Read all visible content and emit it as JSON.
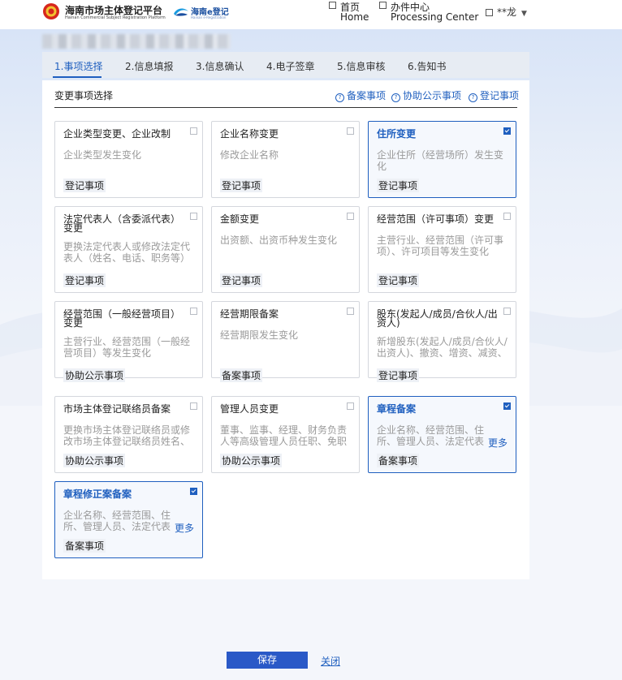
{
  "header": {
    "logo_cn": "海南市场主体登记平台",
    "logo_en": "Hainan Commercial Subject Registration Platform",
    "logo2_text": "海南e登记",
    "logo2_sub": "Hainan e-Registration",
    "nav": [
      {
        "cn": "首页",
        "en": "Home"
      },
      {
        "cn": "办件中心",
        "en": "Processing Center"
      }
    ],
    "user_name": "**龙"
  },
  "steps": [
    "1.事项选择",
    "2.信息填报",
    "3.信息确认",
    "4.电子签章",
    "5.信息审核",
    "6.告知书"
  ],
  "panel": {
    "title": "变更事项选择",
    "help_links": [
      "备案事项",
      "协助公示事项",
      "登记事项"
    ]
  },
  "cards": [
    {
      "title": "企业类型变更、企业改制",
      "desc": "企业类型发生变化",
      "tag": "登记事项",
      "selected": false
    },
    {
      "title": "企业名称变更",
      "desc": "修改企业名称",
      "tag": "登记事项",
      "selected": false
    },
    {
      "title": "住所变更",
      "desc": "企业住所（经营场所）发生变化",
      "tag": "登记事项",
      "selected": true
    },
    {
      "title": "法定代表人（含委派代表）变更",
      "desc": "更换法定代表人或修改法定代表人（姓名、电话、职务等）",
      "tag": "登记事项",
      "selected": false
    },
    {
      "title": "金额变更",
      "desc": "出资额、出资币种发生变化",
      "tag": "登记事项",
      "selected": false
    },
    {
      "title": "经营范围（许可事项）变更",
      "desc": "主营行业、经营范围（许可事项）、许可项目等发生变化",
      "tag": "登记事项",
      "selected": false
    },
    {
      "title": "经营范围（一般经营项目）变更",
      "desc": "主营行业、经营范围（一般经营项目）等发生变化",
      "tag": "协助公示事项",
      "selected": false
    },
    {
      "title": "经营期限备案",
      "desc": "经营期限发生变化",
      "tag": "备案事项",
      "selected": false
    },
    {
      "title": "股东(发起人/成员/合伙人/出资人)",
      "desc": "新增股东(发起人/成员/合伙人/出资人)、撤资、增资、减资、",
      "tag": "登记事项",
      "selected": false
    },
    {
      "title": "市场主体登记联络员备案",
      "desc": "更换市场主体登记联络员或修改市场主体登记联络员姓名、",
      "tag": "协助公示事项",
      "selected": false
    },
    {
      "title": "管理人员变更",
      "desc": "董事、监事、经理、财务负责人等高级管理人员任职、免职",
      "tag": "协助公示事项",
      "selected": false
    },
    {
      "title": "章程备案",
      "desc": "企业名称、经营范围、住所、管理人员、法定代表人、...",
      "tag": "备案事项",
      "selected": true,
      "more": "更多"
    },
    {
      "title": "章程修正案备案",
      "desc": "企业名称、经营范围、住所、管理人员、法定代表人、...",
      "tag": "备案事项",
      "selected": true,
      "more": "更多"
    }
  ],
  "footer": {
    "save": "保存",
    "close": "关闭"
  },
  "colors": {
    "accent": "#1f5fbf",
    "button": "#2a59c7"
  }
}
